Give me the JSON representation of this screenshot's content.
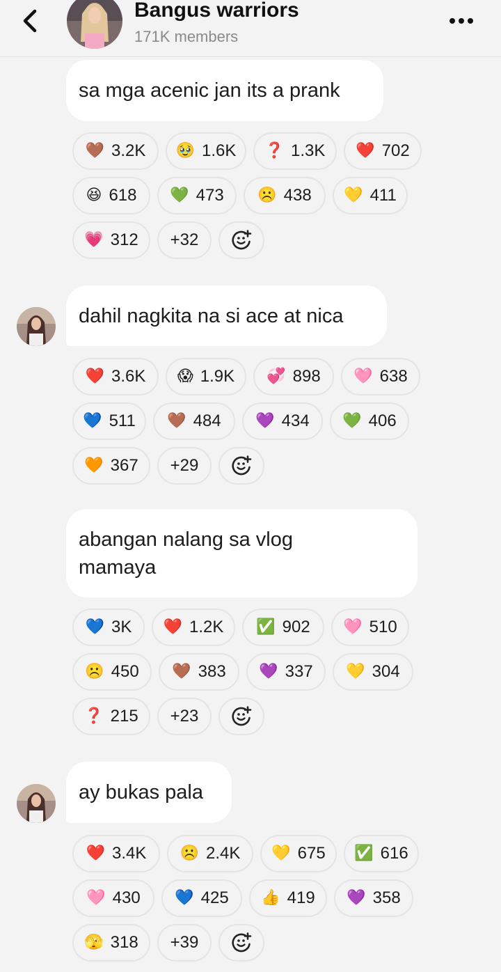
{
  "header": {
    "title": "Bangus warriors",
    "members": "171K members",
    "back_icon": "chevron-left-icon",
    "more_icon": "more-dots-icon"
  },
  "messages": [
    {
      "text_lines": [
        "sa mga acenic jan its a prank"
      ],
      "reactions": [
        {
          "emoji": "🤎",
          "count": "3.2K"
        },
        {
          "emoji": "🥹",
          "count": "1.6K"
        },
        {
          "emoji": "❓",
          "count": "1.3K"
        },
        {
          "emoji": "❤️",
          "count": "702"
        },
        {
          "emoji": "😆",
          "count": "618"
        },
        {
          "emoji": "💚",
          "count": "473"
        },
        {
          "emoji": "☹️",
          "count": "438"
        },
        {
          "emoji": "💛",
          "count": "411"
        },
        {
          "emoji": "💗",
          "count": "312"
        }
      ],
      "more": "+32"
    },
    {
      "text_lines": [
        "dahil nagkita na si ace at nica"
      ],
      "reactions": [
        {
          "emoji": "❤️",
          "count": "3.6K"
        },
        {
          "emoji": "😱",
          "count": "1.9K"
        },
        {
          "emoji": "💞",
          "count": "898"
        },
        {
          "emoji": "🩷",
          "count": "638"
        },
        {
          "emoji": "💙",
          "count": "511"
        },
        {
          "emoji": "🤎",
          "count": "484"
        },
        {
          "emoji": "💜",
          "count": "434"
        },
        {
          "emoji": "💚",
          "count": "406"
        },
        {
          "emoji": "🧡",
          "count": "367"
        }
      ],
      "more": "+29"
    },
    {
      "text_lines": [
        "abangan nalang sa vlog",
        "mamaya"
      ],
      "reactions": [
        {
          "emoji": "💙",
          "count": "3K"
        },
        {
          "emoji": "❤️",
          "count": "1.2K"
        },
        {
          "emoji": "✅",
          "count": "902"
        },
        {
          "emoji": "🩷",
          "count": "510"
        },
        {
          "emoji": "☹️",
          "count": "450"
        },
        {
          "emoji": "🤎",
          "count": "383"
        },
        {
          "emoji": "💜",
          "count": "337"
        },
        {
          "emoji": "💛",
          "count": "304"
        },
        {
          "emoji": "❓",
          "count": "215"
        }
      ],
      "more": "+23"
    },
    {
      "text_lines": [
        "ay bukas pala"
      ],
      "reactions": [
        {
          "emoji": "❤️",
          "count": "3.4K"
        },
        {
          "emoji": "☹️",
          "count": "2.4K"
        },
        {
          "emoji": "💛",
          "count": "675"
        },
        {
          "emoji": "✅",
          "count": "616"
        },
        {
          "emoji": "🩷",
          "count": "430"
        },
        {
          "emoji": "💙",
          "count": "425"
        },
        {
          "emoji": "👍",
          "count": "419"
        },
        {
          "emoji": "💜",
          "count": "358"
        },
        {
          "emoji": "🫣",
          "count": "318"
        }
      ],
      "more": "+39"
    }
  ],
  "add_reaction_icon": "add-reaction-icon"
}
